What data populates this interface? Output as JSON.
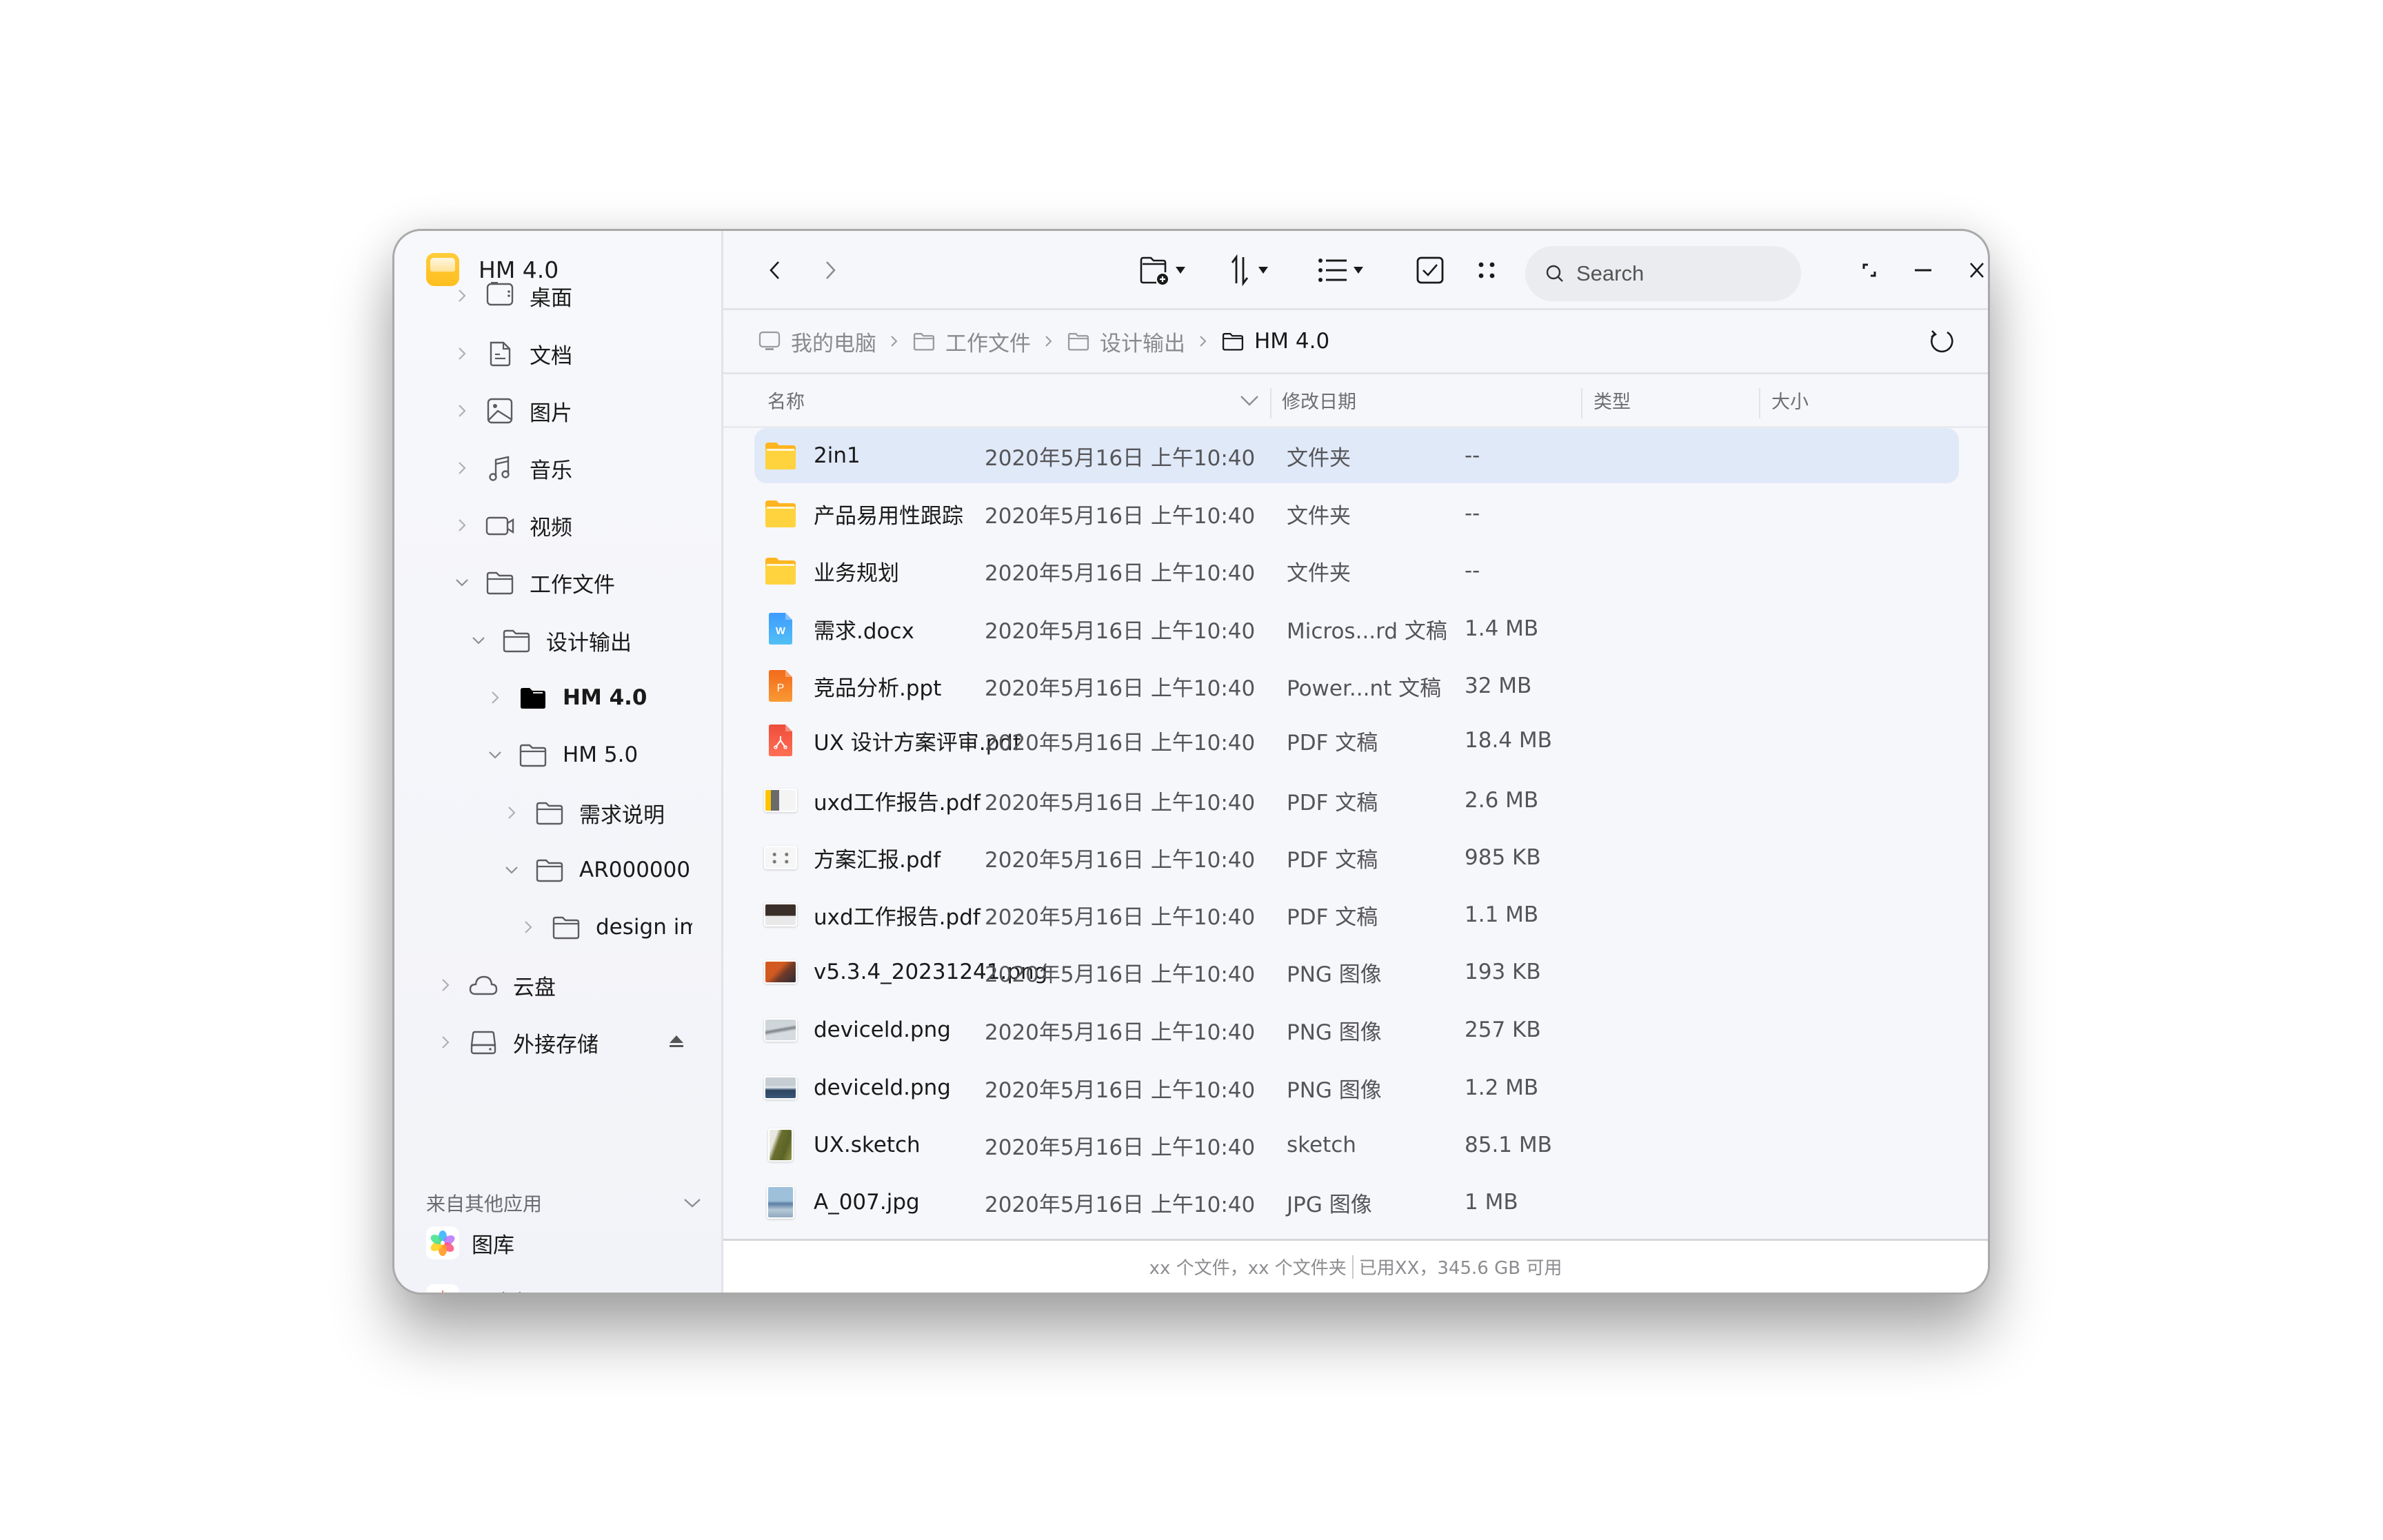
{
  "window": {
    "app_title": "HM 4.0",
    "accent_color": "#e0e9f8"
  },
  "sidebar": {
    "tree": [
      {
        "label": "桌面",
        "icon": "desktop-icon",
        "expanded": false,
        "level": 0
      },
      {
        "label": "文档",
        "icon": "document-icon",
        "expanded": false,
        "level": 0
      },
      {
        "label": "图片",
        "icon": "image-icon",
        "expanded": false,
        "level": 0
      },
      {
        "label": "音乐",
        "icon": "music-icon",
        "expanded": false,
        "level": 0
      },
      {
        "label": "视频",
        "icon": "video-icon",
        "expanded": false,
        "level": 0
      },
      {
        "label": "工作文件",
        "icon": "folder-icon",
        "expanded": true,
        "level": 0
      },
      {
        "label": "设计输出",
        "icon": "folder-icon",
        "expanded": true,
        "level": 1
      },
      {
        "label": "HM 4.0",
        "icon": "folder-filled-icon",
        "expanded": false,
        "level": 2,
        "selected": true
      },
      {
        "label": "HM 5.0",
        "icon": "folder-icon",
        "expanded": true,
        "level": 2
      },
      {
        "label": "需求说明",
        "icon": "folder-icon",
        "expanded": false,
        "level": 3
      },
      {
        "label": "AR000000",
        "icon": "folder-icon",
        "expanded": true,
        "level": 3
      },
      {
        "label": "design im",
        "icon": "folder-icon",
        "expanded": false,
        "level": 4
      },
      {
        "label": "云盘",
        "icon": "cloud-icon",
        "expanded": false,
        "level": -1
      },
      {
        "label": "外接存储",
        "icon": "drive-icon",
        "expanded": false,
        "level": -1,
        "eject": true
      }
    ],
    "other_apps_title": "来自其他应用",
    "other_apps": [
      {
        "label": "图库",
        "icon": "gallery-app-icon"
      },
      {
        "label": "录音机",
        "icon": "recorder-app-icon"
      }
    ]
  },
  "toolbar": {
    "back": "back",
    "forward": "forward",
    "new_folder": "new-folder",
    "sort": "sort",
    "view": "view",
    "multi_select": "select",
    "more": "more",
    "search_placeholder": "Search",
    "search_value": ""
  },
  "breadcrumb": [
    {
      "label": "我的电脑",
      "icon": "computer-icon"
    },
    {
      "label": "工作文件",
      "icon": "folder-icon"
    },
    {
      "label": "设计输出",
      "icon": "folder-icon"
    },
    {
      "label": "HM 4.0",
      "icon": "folder-icon",
      "current": true
    }
  ],
  "columns": {
    "name": "名称",
    "date": "修改日期",
    "type": "类型",
    "size": "大小"
  },
  "files": [
    {
      "name": "2in1",
      "date": "2020年5月16日  上午10:40",
      "type": "文件夹",
      "size": "--",
      "icon": "folder",
      "selected": true
    },
    {
      "name": "产品易用性跟踪",
      "date": "2020年5月16日  上午10:40",
      "type": "文件夹",
      "size": "--",
      "icon": "folder"
    },
    {
      "name": "业务规划",
      "date": "2020年5月16日  上午10:40",
      "type": "文件夹",
      "size": "--",
      "icon": "folder"
    },
    {
      "name": "需求.docx",
      "date": "2020年5月16日  上午10:40",
      "type": "Micros...rd 文稿",
      "size": "1.4 MB",
      "icon": "word"
    },
    {
      "name": "竞品分析.ppt",
      "date": "2020年5月16日  上午10:40",
      "type": "Power...nt 文稿",
      "size": "32 MB",
      "icon": "ppt"
    },
    {
      "name": "UX 设计方案评审.pdf",
      "date": "2020年5月16日  上午10:40",
      "type": "PDF 文稿",
      "size": "18.4 MB",
      "icon": "pdf"
    },
    {
      "name": "uxd工作报告.pdf",
      "date": "2020年5月16日  上午10:40",
      "type": "PDF 文稿",
      "size": "2.6 MB",
      "icon": "thumb-report-yellow"
    },
    {
      "name": "方案汇报.pdf",
      "date": "2020年5月16日  上午10:40",
      "type": "PDF 文稿",
      "size": "985 KB",
      "icon": "thumb-slides"
    },
    {
      "name": "uxd工作报告.pdf",
      "date": "2020年5月16日  上午10:40",
      "type": "PDF 文稿",
      "size": "1.1 MB",
      "icon": "thumb-report-dark"
    },
    {
      "name": "v5.3.4_20231241.png",
      "date": "2020年5月16日  上午10:40",
      "type": "PNG 图像",
      "size": "193 KB",
      "icon": "thumb-desert"
    },
    {
      "name": "deviceld.png",
      "date": "2020年5月16日  上午10:40",
      "type": "PNG 图像",
      "size": "257 KB",
      "icon": "thumb-mist"
    },
    {
      "name": "deviceld.png",
      "date": "2020年5月16日  上午10:40",
      "type": "PNG 图像",
      "size": "1.2 MB",
      "icon": "thumb-mountain"
    },
    {
      "name": "UX.sketch",
      "date": "2020年5月16日  上午10:40",
      "type": "sketch",
      "size": "85.1 MB",
      "icon": "thumb-sketch"
    },
    {
      "name": "A_007.jpg",
      "date": "2020年5月16日  上午10:40",
      "type": "JPG 图像",
      "size": "1 MB",
      "icon": "thumb-fuji"
    }
  ],
  "status": {
    "counts": "xx 个文件，xx 个文件夹",
    "storage": "已用XX，345.6 GB 可用"
  }
}
